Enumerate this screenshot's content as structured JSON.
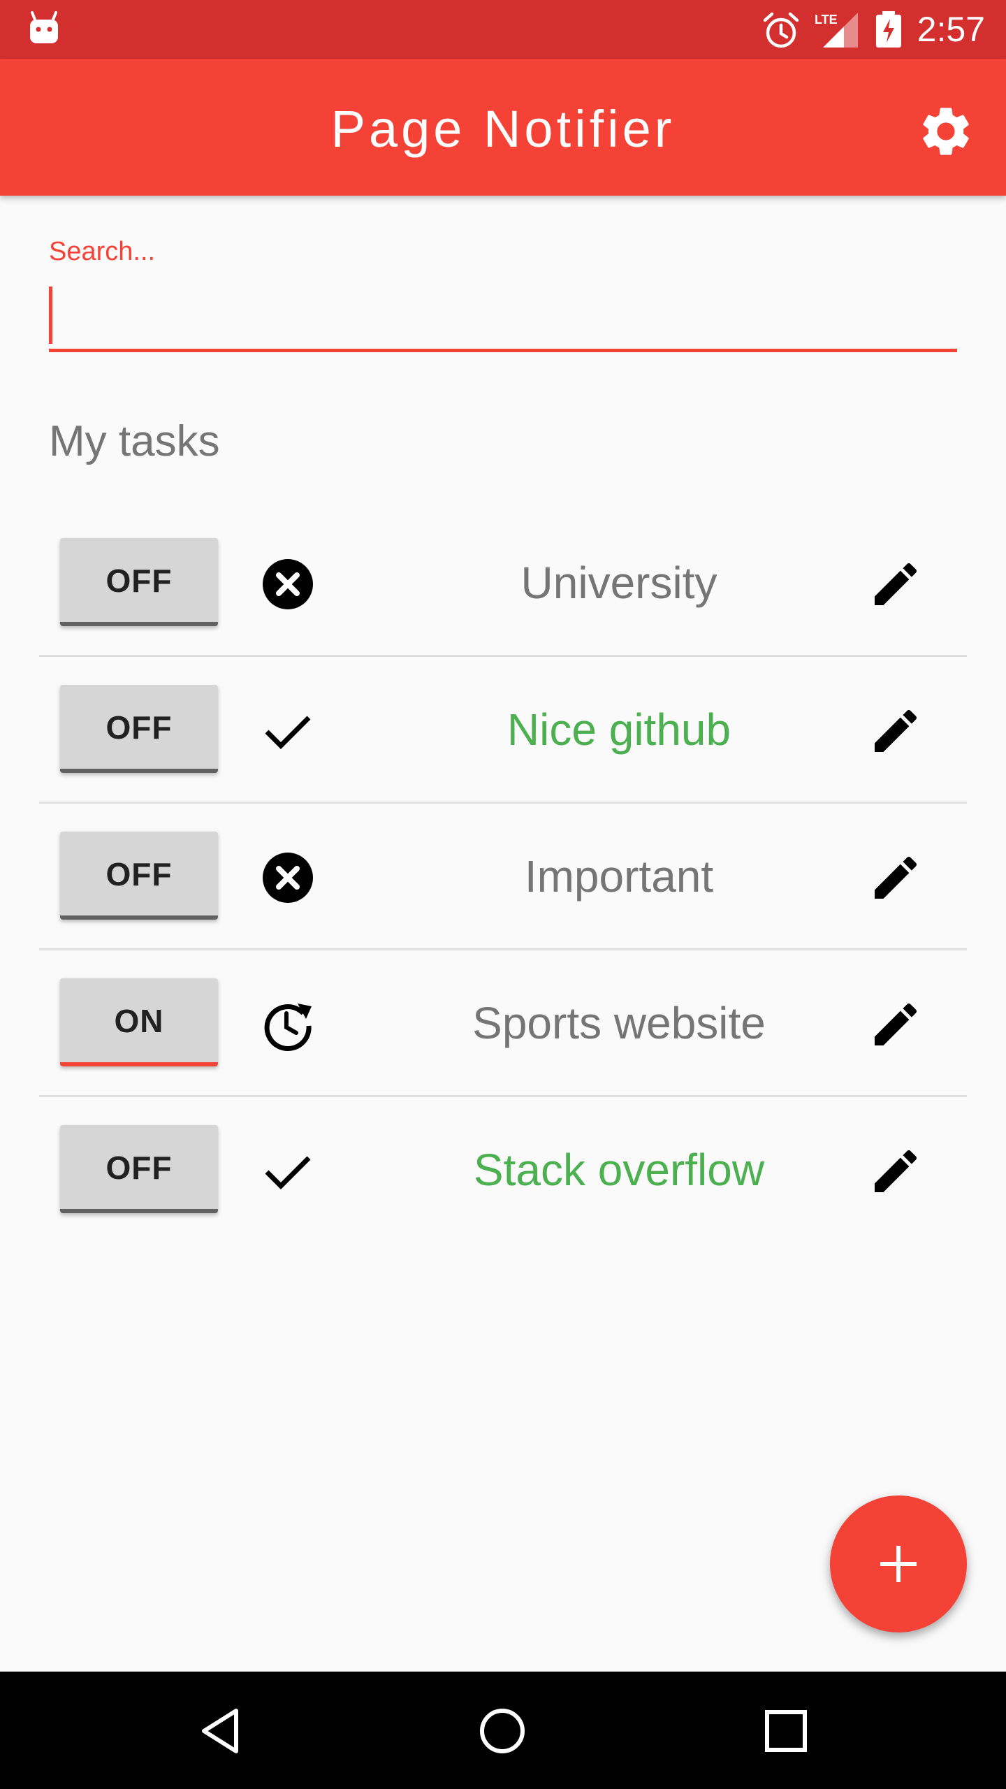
{
  "status_bar": {
    "time": "2:57",
    "icons": [
      "android-notification-icon",
      "alarm-icon",
      "lte-signal-icon",
      "battery-charging-icon"
    ]
  },
  "app_bar": {
    "title": "Page Notifier",
    "settings_icon": "gear-icon"
  },
  "search": {
    "label": "Search...",
    "value": "",
    "placeholder": ""
  },
  "section_heading": "My tasks",
  "tasks": [
    {
      "toggle": "OFF",
      "status": "error",
      "status_icon": "x-circle-icon",
      "name": "University",
      "name_color": "#757575"
    },
    {
      "toggle": "OFF",
      "status": "success",
      "status_icon": "check-icon",
      "name": "Nice github",
      "name_color": "#4caf50"
    },
    {
      "toggle": "OFF",
      "status": "error",
      "status_icon": "x-circle-icon",
      "name": "Important",
      "name_color": "#757575"
    },
    {
      "toggle": "ON",
      "status": "scheduled",
      "status_icon": "clock-refresh-icon",
      "name": "Sports website",
      "name_color": "#757575"
    },
    {
      "toggle": "OFF",
      "status": "success",
      "status_icon": "check-icon",
      "name": "Stack overflow",
      "name_color": "#4caf50"
    }
  ],
  "fab": {
    "icon": "plus-icon"
  },
  "nav_bar": {
    "icons": [
      "back-icon",
      "home-icon",
      "recent-apps-icon"
    ]
  },
  "colors": {
    "status_bar": "#d32f2f",
    "primary": "#f44336",
    "success": "#4caf50",
    "muted_text": "#757575",
    "toggle_bg": "#d6d6d6"
  }
}
